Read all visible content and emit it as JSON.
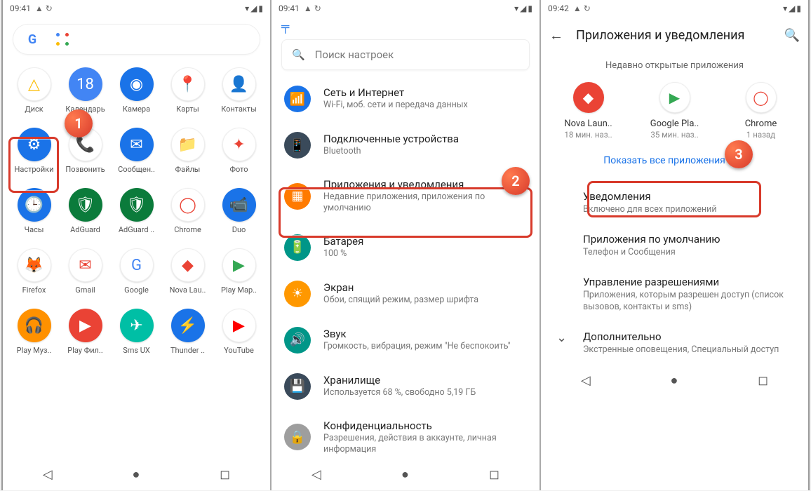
{
  "status": {
    "times": [
      "09:41",
      "09:41",
      "09:42"
    ]
  },
  "screen1": {
    "apps": [
      {
        "label": "Диск",
        "bg": "#fff",
        "glyph": "△",
        "fg": "#fbbc05"
      },
      {
        "label": "Календарь",
        "bg": "#4285f4",
        "glyph": "18",
        "fg": "#fff"
      },
      {
        "label": "Камера",
        "bg": "#1a73e8",
        "glyph": "◉",
        "fg": "#fff"
      },
      {
        "label": "Карты",
        "bg": "#fff",
        "glyph": "📍",
        "fg": "#34a853"
      },
      {
        "label": "Контакты",
        "bg": "#fff",
        "glyph": "👤",
        "fg": "#1a73e8"
      },
      {
        "label": "Настройки",
        "bg": "#1a73e8",
        "glyph": "⚙",
        "fg": "#fff"
      },
      {
        "label": "Позвонить",
        "bg": "#fff",
        "glyph": "📞",
        "fg": "#1a73e8"
      },
      {
        "label": "Сообщен..",
        "bg": "#1a73e8",
        "glyph": "✉",
        "fg": "#fff"
      },
      {
        "label": "Файлы",
        "bg": "#fff",
        "glyph": "📁",
        "fg": "#1a73e8"
      },
      {
        "label": "Фото",
        "bg": "#fff",
        "glyph": "✦",
        "fg": "#ea4335"
      },
      {
        "label": "Часы",
        "bg": "#1a73e8",
        "glyph": "🕒",
        "fg": "#fff"
      },
      {
        "label": "AdGuard",
        "bg": "#0b7b3b",
        "glyph": "🛡",
        "fg": "#fff"
      },
      {
        "label": "AdGuard ..",
        "bg": "#0b7b3b",
        "glyph": "🛡",
        "fg": "#fff"
      },
      {
        "label": "Chrome",
        "bg": "#fff",
        "glyph": "◯",
        "fg": "#ea4335"
      },
      {
        "label": "Duo",
        "bg": "#1a73e8",
        "glyph": "📹",
        "fg": "#fff"
      },
      {
        "label": "Firefox",
        "bg": "#fff",
        "glyph": "🦊",
        "fg": "#ff7139"
      },
      {
        "label": "Gmail",
        "bg": "#fff",
        "glyph": "✉",
        "fg": "#ea4335"
      },
      {
        "label": "Google",
        "bg": "#fff",
        "glyph": "G",
        "fg": "#4285f4"
      },
      {
        "label": "Nova Lau..",
        "bg": "#fff",
        "glyph": "◆",
        "fg": "#ea4335"
      },
      {
        "label": "Play Мар..",
        "bg": "#fff",
        "glyph": "▶",
        "fg": "#34a853"
      },
      {
        "label": "Play Муз..",
        "bg": "#ff9100",
        "glyph": "🎧",
        "fg": "#fff"
      },
      {
        "label": "Play Фил..",
        "bg": "#ea4335",
        "glyph": "▶",
        "fg": "#fff"
      },
      {
        "label": "Sms UX",
        "bg": "#00bfa5",
        "glyph": "✈",
        "fg": "#fff"
      },
      {
        "label": "Thunder ..",
        "bg": "#1a73e8",
        "glyph": "⚡",
        "fg": "#fff"
      },
      {
        "label": "YouTube",
        "bg": "#fff",
        "glyph": "▶",
        "fg": "#ff0000"
      }
    ]
  },
  "screen2": {
    "search_placeholder": "Поиск настроек",
    "items": [
      {
        "title": "Сеть и Интернет",
        "sub": "Wi-Fi, моб. сети и передача данных",
        "bg": "#1a73e8",
        "glyph": "📶"
      },
      {
        "title": "Подключенные устройства",
        "sub": "Bluetooth",
        "bg": "#3a4a5a",
        "glyph": "📱"
      },
      {
        "title": "Приложения и уведомления",
        "sub": "Недавние приложения, приложения по умолчанию",
        "bg": "#ff7a00",
        "glyph": "▦"
      },
      {
        "title": "Батарея",
        "sub": "100 %",
        "bg": "#009688",
        "glyph": "🔋"
      },
      {
        "title": "Экран",
        "sub": "Обои, спящий режим, размер шрифта",
        "bg": "#ff9800",
        "glyph": "☀"
      },
      {
        "title": "Звук",
        "sub": "Громкость, вибрация, режим \"Не беспокоить\"",
        "bg": "#009688",
        "glyph": "🔊"
      },
      {
        "title": "Хранилище",
        "sub": "Используется 68 %, свободно 5,19 ГБ",
        "bg": "#3a4a5a",
        "glyph": "💾"
      },
      {
        "title": "Конфиденциальность",
        "sub": "Разрешения, действия в аккаунте, личная информация",
        "bg": "#9e9e9e",
        "glyph": "🔒"
      }
    ]
  },
  "screen3": {
    "title": "Приложения и уведомления",
    "section_header": "Недавно открытые приложения",
    "recent": [
      {
        "name": "Nova Laun..",
        "sub": "18 мин. наз..",
        "bg": "#ea4335",
        "glyph": "◆"
      },
      {
        "name": "Google Pla..",
        "sub": "35 мин. наз..",
        "bg": "#fff",
        "glyph": "▶",
        "fg": "#34a853"
      },
      {
        "name": "Chrome",
        "sub": "1 назад",
        "bg": "#fff",
        "glyph": "◯",
        "fg": "#ea4335"
      }
    ],
    "show_all": "Показать все приложения (37)",
    "prefs": [
      {
        "title": "Уведомления",
        "sub": "Включено для всех приложений"
      },
      {
        "title": "Приложения по умолчанию",
        "sub": "Телефон и Сообщения"
      },
      {
        "title": "Управление разрешениями",
        "sub": "Приложения, которым разрешен доступ (список вызовов, контакты и sms)"
      },
      {
        "title": "Дополнительно",
        "sub": "Экстренные оповещения, Специальный доступ",
        "chev": true
      }
    ]
  },
  "badges": {
    "b1": "1",
    "b2": "2",
    "b3": "3"
  }
}
